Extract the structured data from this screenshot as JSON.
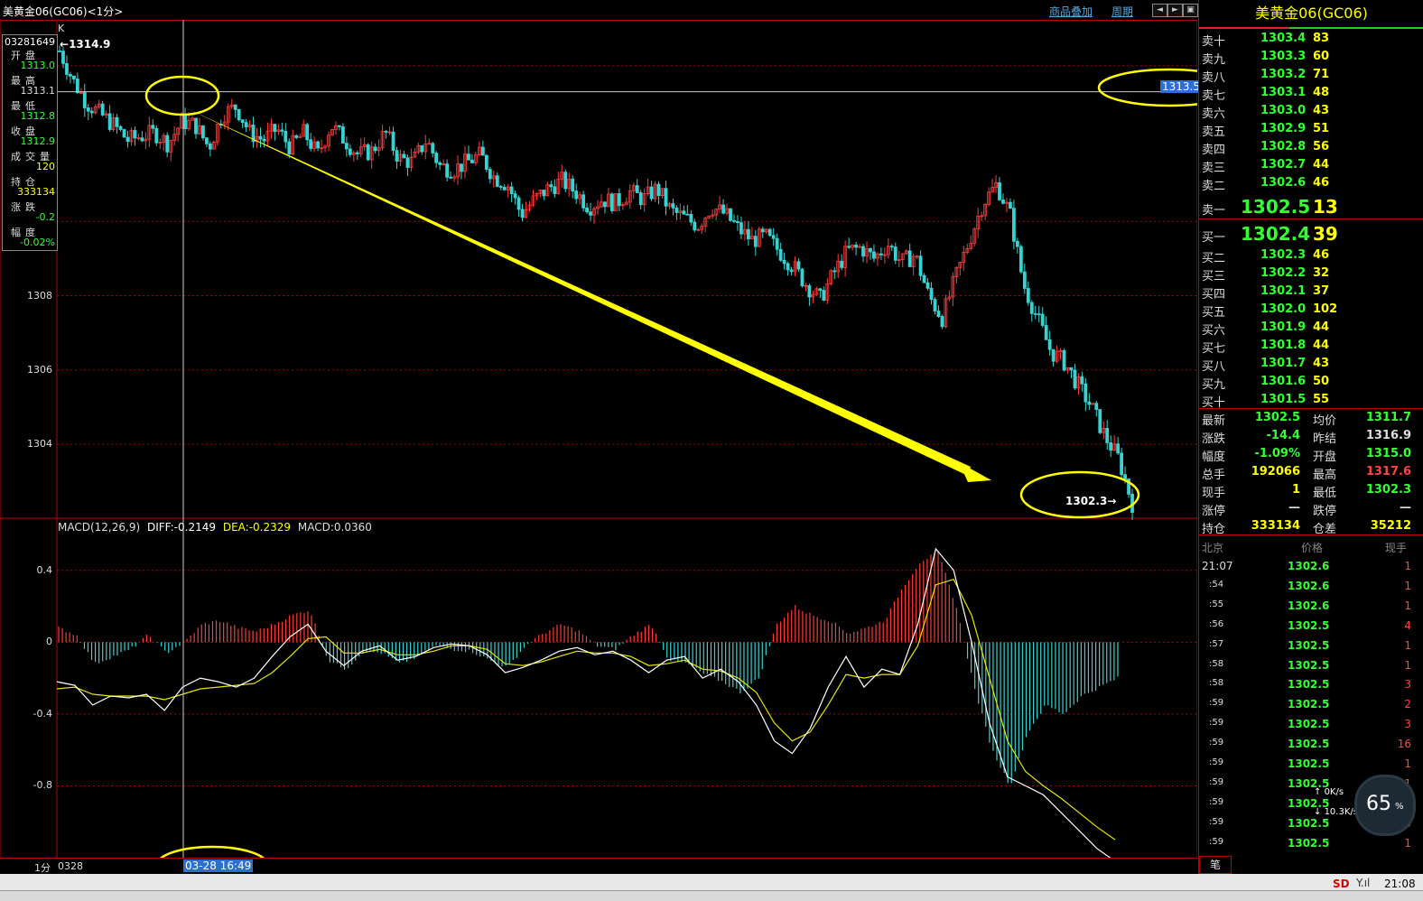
{
  "window_title": "美黄金06(GC06)<1分>",
  "toolbar": {
    "overlay_link": "商品叠加",
    "period_link": "周期",
    "nav_left": "◄",
    "nav_right": "►",
    "nav_restore": "▣"
  },
  "infobox": {
    "date_code": "03281649",
    "rows": [
      {
        "label": "开盘",
        "value": "1313.0",
        "color": "#3f3"
      },
      {
        "label": "最高",
        "value": "1313.1",
        "color": "#ddd"
      },
      {
        "label": "最低",
        "value": "1312.8",
        "color": "#3f3"
      },
      {
        "label": "收盘",
        "value": "1312.9",
        "color": "#3f3"
      },
      {
        "label": "成交量",
        "value": "120",
        "color": "#ff0"
      },
      {
        "label": "持仓",
        "value": "333134",
        "color": "#ff0"
      },
      {
        "label": "涨跌",
        "value": "-0.2",
        "color": "#3f3"
      },
      {
        "label": "幅度",
        "value": "-0.02%",
        "color": "#3f3"
      }
    ]
  },
  "chart_data": [
    {
      "type": "candlestick",
      "label_k": "K",
      "ylim": [
        1302.0,
        1315.0
      ],
      "y_ticks": [
        "1308",
        "1306",
        "1304"
      ],
      "y_tick_values": [
        1308,
        1306,
        1304
      ],
      "crosshair_price": "1313.5",
      "crosshair_value": 1313.5,
      "high_annotation": "1314.9",
      "low_annotation": "1302.3",
      "close_path": [
        1314.6,
        1313.8,
        1313.2,
        1312.9,
        1312.6,
        1312.2,
        1312.3,
        1312.4,
        1312.1,
        1312.7,
        1312.6,
        1312.0,
        1312.9,
        1313.1,
        1312.4,
        1312.2,
        1312.5,
        1312.0,
        1312.4,
        1311.8,
        1312.6,
        1312.2,
        1311.8,
        1311.9,
        1312.4,
        1311.7,
        1311.6,
        1312.2,
        1311.5,
        1311.4,
        1311.6,
        1311.8,
        1311.2,
        1311.0,
        1310.2,
        1310.6,
        1310.9,
        1311.1,
        1310.8,
        1310.4,
        1310.6,
        1310.5,
        1310.8,
        1310.6,
        1310.9,
        1310.3,
        1310.1,
        1309.9,
        1310.4,
        1310.2,
        1309.8,
        1309.5,
        1309.6,
        1309.2,
        1308.8,
        1308.3,
        1307.9,
        1308.6,
        1309.2,
        1309.3,
        1309.0,
        1309.4,
        1308.9,
        1309.1,
        1308.0,
        1307.4,
        1308.5,
        1309.5,
        1310.5,
        1311.0,
        1310.2,
        1308.3,
        1307.4,
        1306.5,
        1306.2,
        1305.6,
        1305.0,
        1304.2,
        1303.6,
        1302.4
      ],
      "volume_unit": "K"
    },
    {
      "type": "macd",
      "params": "MACD(12,26,9)",
      "diff_label": "DIFF:",
      "diff": "-0.2149",
      "dea_label": "DEA:",
      "dea": "-0.2329",
      "macd_label": "MACD:",
      "macd": "0.0360",
      "ylim": [
        -1.2,
        0.6
      ],
      "y_ticks": [
        "0.4",
        "0",
        "-0.4",
        "-0.8"
      ],
      "y_tick_values": [
        0.4,
        0,
        -0.4,
        -0.8
      ],
      "diff_path": [
        -0.22,
        -0.24,
        -0.35,
        -0.3,
        -0.31,
        -0.29,
        -0.38,
        -0.25,
        -0.2,
        -0.22,
        -0.25,
        -0.2,
        -0.08,
        0.03,
        0.1,
        -0.05,
        -0.13,
        -0.05,
        -0.02,
        -0.1,
        -0.08,
        -0.03,
        -0.01,
        -0.02,
        -0.07,
        -0.17,
        -0.14,
        -0.1,
        -0.05,
        -0.03,
        -0.07,
        -0.05,
        -0.1,
        -0.17,
        -0.1,
        -0.08,
        -0.2,
        -0.15,
        -0.22,
        -0.35,
        -0.55,
        -0.62,
        -0.48,
        -0.25,
        -0.08,
        -0.25,
        -0.15,
        -0.18,
        0.1,
        0.52,
        0.4,
        0.0,
        -0.45,
        -0.75,
        -0.8,
        -0.85,
        -0.95,
        -1.05,
        -1.15,
        -1.22
      ],
      "dea_path": [
        -0.26,
        -0.25,
        -0.29,
        -0.3,
        -0.3,
        -0.3,
        -0.32,
        -0.29,
        -0.26,
        -0.25,
        -0.24,
        -0.23,
        -0.17,
        -0.08,
        0.02,
        0.03,
        -0.06,
        -0.06,
        -0.04,
        -0.07,
        -0.07,
        -0.05,
        -0.02,
        -0.02,
        -0.04,
        -0.12,
        -0.13,
        -0.11,
        -0.08,
        -0.05,
        -0.06,
        -0.06,
        -0.08,
        -0.13,
        -0.12,
        -0.1,
        -0.15,
        -0.16,
        -0.2,
        -0.28,
        -0.45,
        -0.55,
        -0.5,
        -0.35,
        -0.18,
        -0.2,
        -0.18,
        -0.18,
        -0.02,
        0.32,
        0.35,
        0.15,
        -0.2,
        -0.55,
        -0.72,
        -0.8,
        -0.87,
        -0.95,
        -1.03,
        -1.1
      ],
      "hist_path": [
        0.08,
        0.04,
        -0.12,
        -0.08,
        -0.04,
        0.04,
        -0.06,
        0.0,
        0.1,
        0.12,
        0.08,
        0.06,
        0.1,
        0.15,
        0.18,
        -0.1,
        -0.15,
        -0.05,
        -0.06,
        -0.12,
        -0.08,
        -0.02,
        -0.04,
        -0.05,
        -0.1,
        -0.14,
        -0.02,
        0.05,
        0.1,
        0.06,
        -0.02,
        -0.04,
        0.04,
        0.1,
        -0.1,
        -0.12,
        -0.18,
        -0.22,
        -0.28,
        -0.2,
        0.1,
        0.2,
        0.15,
        0.12,
        0.05,
        0.08,
        0.12,
        0.3,
        0.45,
        0.5,
        0.2,
        -0.25,
        -0.6,
        -0.8,
        -0.5,
        -0.35,
        -0.4,
        -0.3,
        -0.25,
        -0.2
      ]
    }
  ],
  "bottom_axis": {
    "period": "1分",
    "start_date": "0328",
    "cursor_time": "03-28 16:49"
  },
  "orderbook": {
    "title": "美黄金06(GC06)",
    "asks": [
      {
        "label": "卖十",
        "price": "1303.4",
        "vol": "83"
      },
      {
        "label": "卖九",
        "price": "1303.3",
        "vol": "60"
      },
      {
        "label": "卖八",
        "price": "1303.2",
        "vol": "71"
      },
      {
        "label": "卖七",
        "price": "1303.1",
        "vol": "48"
      },
      {
        "label": "卖六",
        "price": "1303.0",
        "vol": "43"
      },
      {
        "label": "卖五",
        "price": "1302.9",
        "vol": "51"
      },
      {
        "label": "卖四",
        "price": "1302.8",
        "vol": "56"
      },
      {
        "label": "卖三",
        "price": "1302.7",
        "vol": "44"
      },
      {
        "label": "卖二",
        "price": "1302.6",
        "vol": "46"
      }
    ],
    "ask1": {
      "label": "卖一",
      "price": "1302.5",
      "vol": "13"
    },
    "bid1": {
      "label": "买一",
      "price": "1302.4",
      "vol": "39"
    },
    "bids": [
      {
        "label": "买二",
        "price": "1302.3",
        "vol": "46"
      },
      {
        "label": "买三",
        "price": "1302.2",
        "vol": "32"
      },
      {
        "label": "买四",
        "price": "1302.1",
        "vol": "37"
      },
      {
        "label": "买五",
        "price": "1302.0",
        "vol": "102"
      },
      {
        "label": "买六",
        "price": "1301.9",
        "vol": "44"
      },
      {
        "label": "买七",
        "price": "1301.8",
        "vol": "44"
      },
      {
        "label": "买八",
        "price": "1301.7",
        "vol": "43"
      },
      {
        "label": "买九",
        "price": "1301.6",
        "vol": "50"
      },
      {
        "label": "买十",
        "price": "1301.5",
        "vol": "55"
      }
    ]
  },
  "stats": [
    {
      "l1": "最新",
      "v1": "1302.5",
      "c1": "#3f3",
      "l2": "均价",
      "v2": "1311.7",
      "c2": "#3f3"
    },
    {
      "l1": "涨跌",
      "v1": "-14.4",
      "c1": "#3f3",
      "l2": "昨结",
      "v2": "1316.9",
      "c2": "#ddd"
    },
    {
      "l1": "幅度",
      "v1": "-1.09%",
      "c1": "#3f3",
      "l2": "开盘",
      "v2": "1315.0",
      "c2": "#3f3"
    },
    {
      "l1": "总手",
      "v1": "192066",
      "c1": "#ff0",
      "l2": "最高",
      "v2": "1317.6",
      "c2": "#f44"
    },
    {
      "l1": "现手",
      "v1": "1",
      "c1": "#ff0",
      "l2": "最低",
      "v2": "1302.3",
      "c2": "#3f3"
    },
    {
      "l1": "涨停",
      "v1": "—",
      "c1": "#ddd",
      "l2": "跌停",
      "v2": "—",
      "c2": "#ddd"
    },
    {
      "l1": "持仓",
      "v1": "333134",
      "c1": "#ff0",
      "l2": "仓差",
      "v2": "35212",
      "c2": "#ff0"
    }
  ],
  "ticks_header": {
    "time": "北京",
    "price": "价格",
    "vol": "现手"
  },
  "ticks": [
    {
      "time": "21:07",
      "price": "1302.6",
      "vol": "1"
    },
    {
      "time": ":54",
      "price": "1302.6",
      "vol": "1"
    },
    {
      "time": ":55",
      "price": "1302.6",
      "vol": "1"
    },
    {
      "time": ":56",
      "price": "1302.5",
      "vol": "4"
    },
    {
      "time": ":57",
      "price": "1302.5",
      "vol": "1"
    },
    {
      "time": ":58",
      "price": "1302.5",
      "vol": "1"
    },
    {
      "time": ":58",
      "price": "1302.5",
      "vol": "3"
    },
    {
      "time": ":59",
      "price": "1302.5",
      "vol": "2"
    },
    {
      "time": ":59",
      "price": "1302.5",
      "vol": "3"
    },
    {
      "time": ":59",
      "price": "1302.5",
      "vol": "16"
    },
    {
      "time": ":59",
      "price": "1302.5",
      "vol": "1"
    },
    {
      "time": ":59",
      "price": "1302.5",
      "vol": "1"
    },
    {
      "time": ":59",
      "price": "1302.5",
      "vol": "6"
    },
    {
      "time": ":59",
      "price": "1302.5",
      "vol": "6"
    },
    {
      "time": ":59",
      "price": "1302.5",
      "vol": "1"
    }
  ],
  "tick_tab": "笔",
  "speed_widget": {
    "up": "0K/s",
    "down": "10.3K/s",
    "percent": "65",
    "unit": "%"
  },
  "statusbar": {
    "clock": "21:08",
    "sd_label": "SD"
  }
}
